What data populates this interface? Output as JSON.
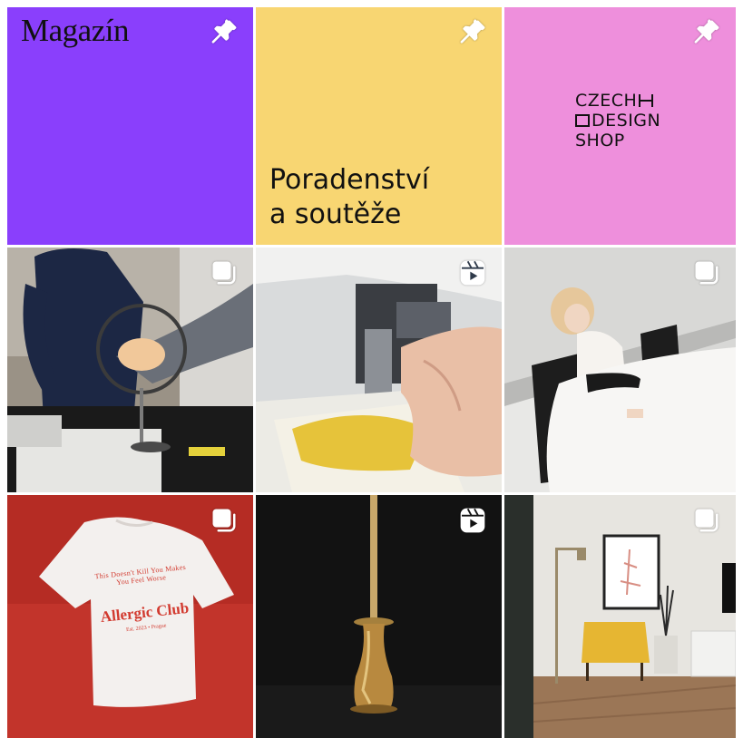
{
  "grid": {
    "tiles": [
      {
        "id": "magazin",
        "title": "Magazín",
        "badge_icon": "pin-icon",
        "background": "#8a3ffc"
      },
      {
        "id": "poradenstvi",
        "title": "Poradenství\na soutěže",
        "badge_icon": "pin-icon",
        "background": "#f8d672"
      },
      {
        "id": "czech-design-shop",
        "logo_lines": [
          "CZECH",
          "DESIGN",
          "SHOP"
        ],
        "badge_icon": "pin-icon",
        "background": "#ee8fdc"
      },
      {
        "id": "lamp-workshop",
        "badge_icon": "carousel-icon",
        "image": "photo of people examining a round mirror lamp on a workbench"
      },
      {
        "id": "sewing-machine",
        "badge_icon": "reels-icon",
        "image": "photo of a hand feeding yellow fabric into a sewing machine"
      },
      {
        "id": "bridal-chair",
        "badge_icon": "carousel-icon",
        "image": "photo of a woman in a white tulle gown on a black leather chair"
      },
      {
        "id": "allergic-club-tshirt",
        "badge_icon": "carousel-icon",
        "tshirt_text": {
          "arc": "This Doesn't Kill You Makes You Feel Worse",
          "club": "Allergic Club",
          "small": "Est. 2023 • Prague"
        },
        "background": "#c2342b"
      },
      {
        "id": "brass-candlestick",
        "badge_icon": "reels-icon",
        "image": "photo of a brass candlestick with a tall candle on black background"
      },
      {
        "id": "interior-yellow-chair",
        "badge_icon": "carousel-icon",
        "image": "photo of a living room with a yellow armchair, floor lamp and framed poster"
      }
    ]
  },
  "colors": {
    "magazin_bg": "#8a3ffc",
    "poradenstvi_bg": "#f8d672",
    "shop_bg": "#ee8fdc",
    "tshirt_bg": "#c2342b",
    "badge": "#ffffff"
  }
}
